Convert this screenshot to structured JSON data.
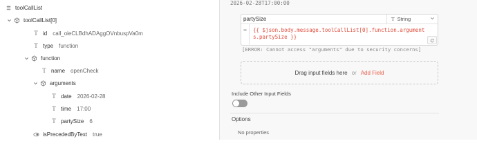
{
  "tree": {
    "rows": [
      {
        "key": "toolCallList",
        "value": "",
        "icon": "list-icon"
      },
      {
        "key": "toolCallList[0]",
        "value": "",
        "icon": "object-icon"
      },
      {
        "key": "id",
        "value": "call_oieCLBdhADAggOVnbuspVa0m",
        "icon": "text-type-icon"
      },
      {
        "key": "type",
        "value": "function",
        "icon": "text-type-icon"
      },
      {
        "key": "function",
        "value": "",
        "icon": "object-icon"
      },
      {
        "key": "name",
        "value": "openCheck",
        "icon": "text-type-icon"
      },
      {
        "key": "arguments",
        "value": "",
        "icon": "object-icon"
      },
      {
        "key": "date",
        "value": "2026-02-28",
        "icon": "text-type-icon"
      },
      {
        "key": "time",
        "value": "17:00",
        "icon": "text-type-icon"
      },
      {
        "key": "partySize",
        "value": "6",
        "icon": "text-type-icon"
      },
      {
        "key": "isPrecededByText",
        "value": "true",
        "icon": "boolean-icon"
      }
    ]
  },
  "right": {
    "date_top": "2026-02-28T17:00:00",
    "field": {
      "name": "partySize",
      "type": "String",
      "eq": "=",
      "expression": "{{ $json.body.message.toolCallList[0].function.arguments.partySize }}"
    },
    "error": "[ERROR: Cannot access \"arguments\" due to security concerns]",
    "drop": {
      "text": "Drag input fields here",
      "or": "or",
      "add": "Add Field"
    },
    "include_label": "Include Other Input Fields",
    "options_label": "Options",
    "no_props": "No properties"
  },
  "colors": {
    "accent": "#e8604c",
    "expression": "#e04b3a"
  }
}
